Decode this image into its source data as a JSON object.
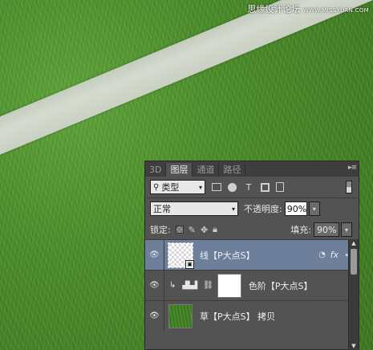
{
  "watermark": {
    "text": "思缘设计论坛",
    "url": "WWW.MISSYUAN.COM"
  },
  "panel": {
    "tabs": [
      "3D",
      "图层",
      "通道",
      "路径"
    ],
    "active_tab": "图层",
    "menu_icon": "panel-menu-icon",
    "filter": {
      "kind_label": "类型",
      "search_icon": "search-icon",
      "buttons": [
        "image-filter-icon",
        "adjustment-filter-icon",
        "type-filter-icon",
        "shape-filter-icon",
        "smart-object-filter-icon"
      ]
    },
    "blend_mode": "正常",
    "opacity_label": "不透明度:",
    "opacity_value": "90%",
    "lock_label": "锁定:",
    "fill_label": "填充:",
    "fill_value": "90%"
  },
  "layers": [
    {
      "name": "线【P大点S】",
      "selected": true,
      "fx": "fx"
    },
    {
      "name": "色阶【P大点S】",
      "selected": false
    },
    {
      "name": "草【P大点S】 拷贝",
      "selected": false
    }
  ]
}
